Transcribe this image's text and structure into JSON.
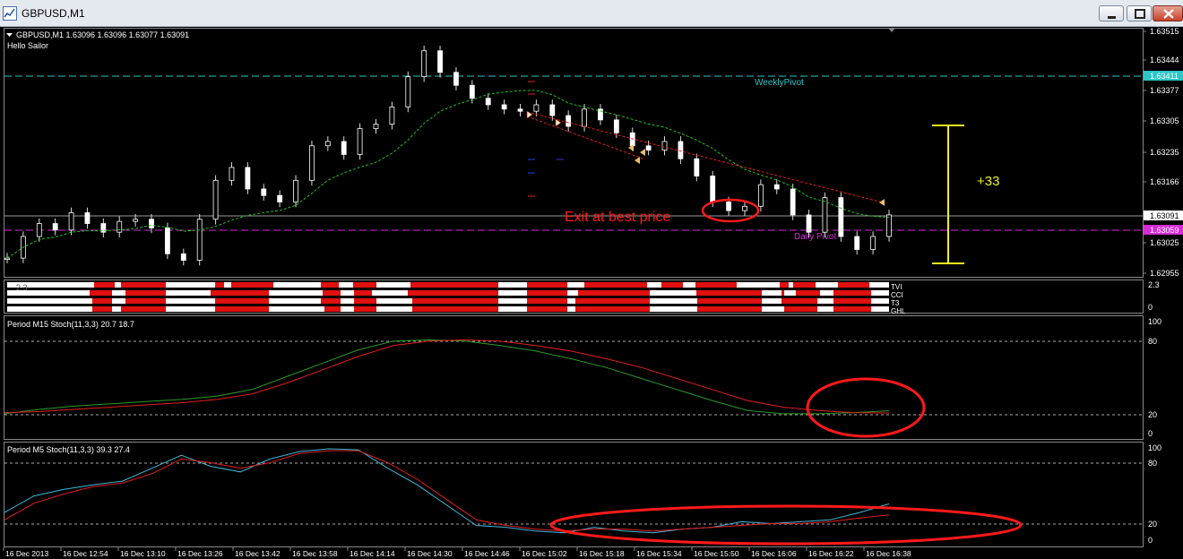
{
  "window": {
    "title": "GBPUSD,M1",
    "icon": "chart-window-icon",
    "controls": [
      "minimize-icon",
      "restore-icon",
      "close-icon"
    ]
  },
  "main_panel": {
    "symbol_info": "GBPUSD,M1  1.63096 1.63096 1.63077 1.63091",
    "indicator_name": "Hello Sailor",
    "weekly_pivot_label": "WeeklyPivot",
    "daily_pivot_label": "Daily Pivot",
    "exit_annotation": "Exit at best price",
    "pip_annotation": "+33",
    "price_ticks": [
      "1.63515",
      "1.63444",
      "1.63377",
      "1.63305",
      "1.63235",
      "1.63166",
      "1.63025",
      "1.62955"
    ],
    "price_tags": {
      "weekly_pivot": "1.63411",
      "current": "1.63091",
      "daily_pivot": "1.63059"
    },
    "colors": {
      "weekly_pivot": "#2cc6c6",
      "daily_pivot": "#d62ad6",
      "annotation": "#ff1a1a",
      "bracket": "#f0f01e",
      "ma": "#22c022"
    }
  },
  "strip_panel": {
    "legend_text": "2.3",
    "scale": [
      "2.3",
      "0"
    ],
    "row_labels": [
      "TVI",
      "CCI",
      "T3",
      "GHL"
    ]
  },
  "m15_stoch": {
    "label": "Period M15 Stoch(11,3,3) 20.7 18.7",
    "scale": [
      "100",
      "80",
      "20",
      "0"
    ]
  },
  "m5_stoch": {
    "label": "Period M5 Stoch(11,3,3) 39.3 27.4",
    "scale": [
      "100",
      "80",
      "20",
      "0"
    ]
  },
  "time_axis": [
    "16 Dec 2013",
    "16 Dec 12:54",
    "16 Dec 13:10",
    "16 Dec 13:26",
    "16 Dec 13:42",
    "16 Dec 13:58",
    "16 Dec 14:14",
    "16 Dec 14:30",
    "16 Dec 14:46",
    "16 Dec 15:02",
    "16 Dec 15:18",
    "16 Dec 15:34",
    "16 Dec 15:50",
    "16 Dec 16:06",
    "16 Dec 16:22",
    "16 Dec 16:38"
  ],
  "price_series_close": [
    1.6299,
    1.6304,
    1.6307,
    1.63055,
    1.63095,
    1.6307,
    1.6305,
    1.63075,
    1.6308,
    1.6306,
    1.63,
    1.62985,
    1.6308,
    1.6317,
    1.632,
    1.6315,
    1.63135,
    1.6312,
    1.6317,
    1.6325,
    1.6326,
    1.6323,
    1.6329,
    1.633,
    1.6334,
    1.6341,
    1.6347,
    1.6342,
    1.6339,
    1.6336,
    1.63345,
    1.63335,
    1.6333,
    1.63345,
    1.6332,
    1.63295,
    1.63335,
    1.6331,
    1.6328,
    1.6325,
    1.6324,
    1.6326,
    1.6322,
    1.6318,
    1.6312,
    1.631,
    1.6311,
    1.6316,
    1.6315,
    1.6309,
    1.6305,
    1.6313,
    1.6304,
    1.6301,
    1.6304,
    1.6309
  ],
  "chart_data": {
    "type": "line",
    "title": "GBPUSD,M1",
    "x_range": [
      "16 Dec 2013",
      "16 Dec 16:38"
    ],
    "y_range": [
      1.62955,
      1.63515
    ],
    "series": [
      {
        "name": "GBPUSD",
        "values": [
          1.6299,
          1.6304,
          1.6307,
          1.63055,
          1.63095,
          1.6307,
          1.6305,
          1.63075,
          1.6308,
          1.6306,
          1.63,
          1.62985,
          1.6308,
          1.6317,
          1.632,
          1.6315,
          1.63135,
          1.6312,
          1.6317,
          1.6325,
          1.6326,
          1.6323,
          1.6329,
          1.633,
          1.6334,
          1.6341,
          1.6347,
          1.6342,
          1.6339,
          1.6336,
          1.63345,
          1.63335,
          1.6333,
          1.63345,
          1.6332,
          1.63295,
          1.63335,
          1.6331,
          1.6328,
          1.6325,
          1.6324,
          1.6326,
          1.6322,
          1.6318,
          1.6312,
          1.631,
          1.6311,
          1.6316,
          1.6315,
          1.6309,
          1.6305,
          1.6313,
          1.6304,
          1.6301,
          1.6304,
          1.6309
        ]
      }
    ],
    "m15_stoch": {
      "main": [
        18,
        22,
        25,
        27,
        29,
        31,
        34,
        40,
        52,
        64,
        76,
        84,
        85,
        84,
        80,
        75,
        68,
        60,
        50,
        40,
        30,
        21,
        18,
        18,
        19,
        20.7
      ],
      "signal": [
        19,
        20,
        22,
        24,
        26,
        28,
        31,
        36,
        46,
        58,
        70,
        80,
        84,
        85,
        84,
        80,
        75,
        68,
        60,
        50,
        40,
        30,
        24,
        21,
        19,
        18.7
      ]
    },
    "m5_stoch": {
      "main": [
        30,
        48,
        55,
        60,
        64,
        78,
        92,
        80,
        74,
        88,
        96,
        99,
        98,
        78,
        60,
        38,
        16,
        14,
        10,
        8,
        14,
        10,
        8,
        12,
        14,
        20,
        18,
        20,
        22,
        30,
        39.3
      ],
      "signal": [
        22,
        40,
        50,
        58,
        62,
        72,
        88,
        84,
        78,
        84,
        94,
        97,
        97,
        84,
        66,
        44,
        22,
        16,
        12,
        10,
        12,
        12,
        10,
        12,
        14,
        16,
        18,
        18,
        20,
        24,
        27.4
      ]
    }
  }
}
